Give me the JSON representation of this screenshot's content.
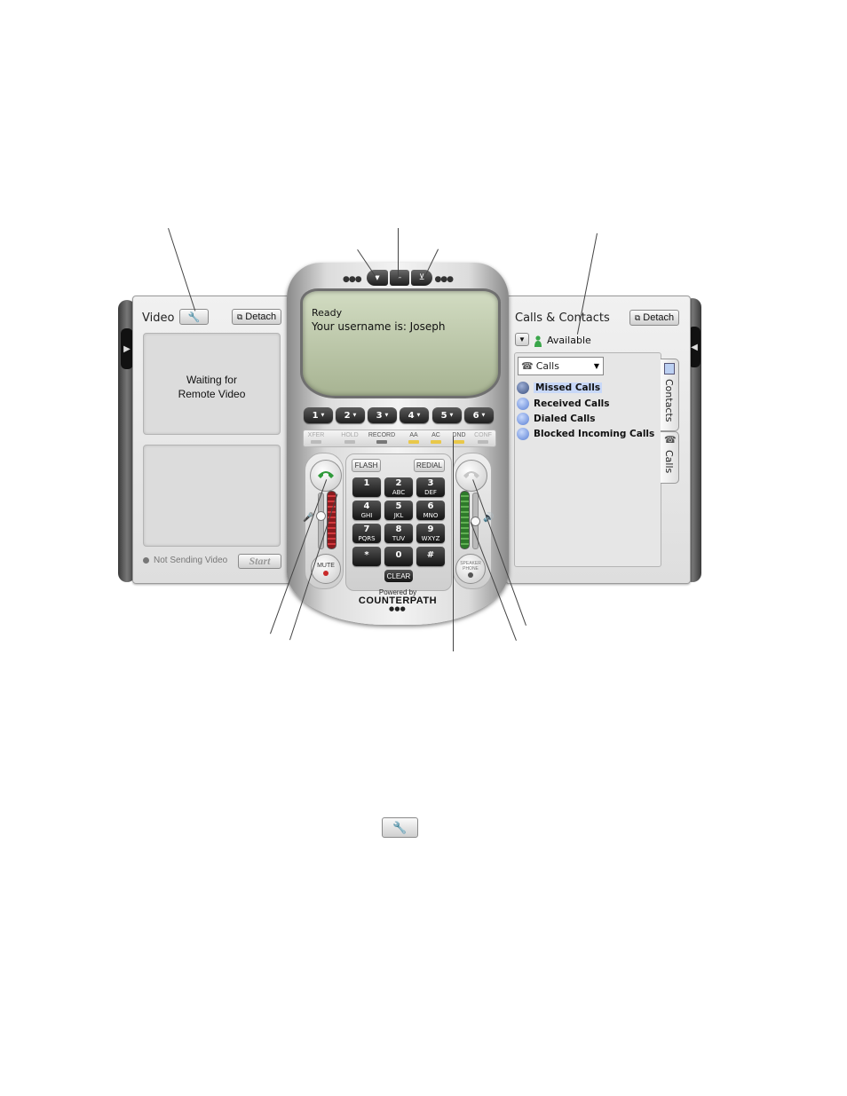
{
  "video_panel": {
    "title": "Video",
    "detach_label": "Detach",
    "waiting_line1": "Waiting for",
    "waiting_line2": "Remote Video",
    "status": "Not Sending Video",
    "start_label": "Start"
  },
  "phone": {
    "display": {
      "status": "Ready",
      "message": "Your username is: Joseph"
    },
    "line_keys": [
      "1",
      "2",
      "3",
      "4",
      "5",
      "6"
    ],
    "feature_keys": [
      {
        "label": "XFER",
        "state": "disabled"
      },
      {
        "label": "HOLD",
        "state": "disabled"
      },
      {
        "label": "RECORD",
        "state": "enabled"
      },
      {
        "label": "AA",
        "state": "enabled"
      },
      {
        "label": "AC",
        "state": "enabled"
      },
      {
        "label": "DND",
        "state": "enabled"
      },
      {
        "label": "CONF",
        "state": "disabled"
      }
    ],
    "flash_label": "FLASH",
    "redial_label": "REDIAL",
    "keypad": [
      {
        "digit": "1",
        "letters": ""
      },
      {
        "digit": "2",
        "letters": "ABC"
      },
      {
        "digit": "3",
        "letters": "DEF"
      },
      {
        "digit": "4",
        "letters": "GHI"
      },
      {
        "digit": "5",
        "letters": "JKL"
      },
      {
        "digit": "6",
        "letters": "MNO"
      },
      {
        "digit": "7",
        "letters": "PQRS"
      },
      {
        "digit": "8",
        "letters": "TUV"
      },
      {
        "digit": "9",
        "letters": "WXYZ"
      },
      {
        "digit": "*",
        "letters": ""
      },
      {
        "digit": "0",
        "letters": ""
      },
      {
        "digit": "#",
        "letters": ""
      }
    ],
    "clear_label": "CLEAR",
    "mute_label": "MUTE",
    "speaker_label_line1": "SPEAKER",
    "speaker_label_line2": "PHONE",
    "brand_line1": "Powered by",
    "brand_line2": "COUNTERPATH",
    "mic_level": 0.6,
    "speaker_level": 0.5
  },
  "contacts_panel": {
    "title": "Calls & Contacts",
    "detach_label": "Detach",
    "availability": "Available",
    "filter_value": "Calls",
    "call_lists": [
      "Missed Calls",
      "Received Calls",
      "Dialed Calls",
      "Blocked Incoming Calls"
    ],
    "selected_index": 0,
    "tabs": [
      "Contacts",
      "Calls"
    ]
  },
  "colors": {
    "selection_highlight": "#c8d8f8",
    "available_green": "#3aa64a",
    "call_button_green": "#2f9a3a",
    "mic_meter_red": "#b8262a",
    "speaker_meter_green": "#4aa040"
  }
}
